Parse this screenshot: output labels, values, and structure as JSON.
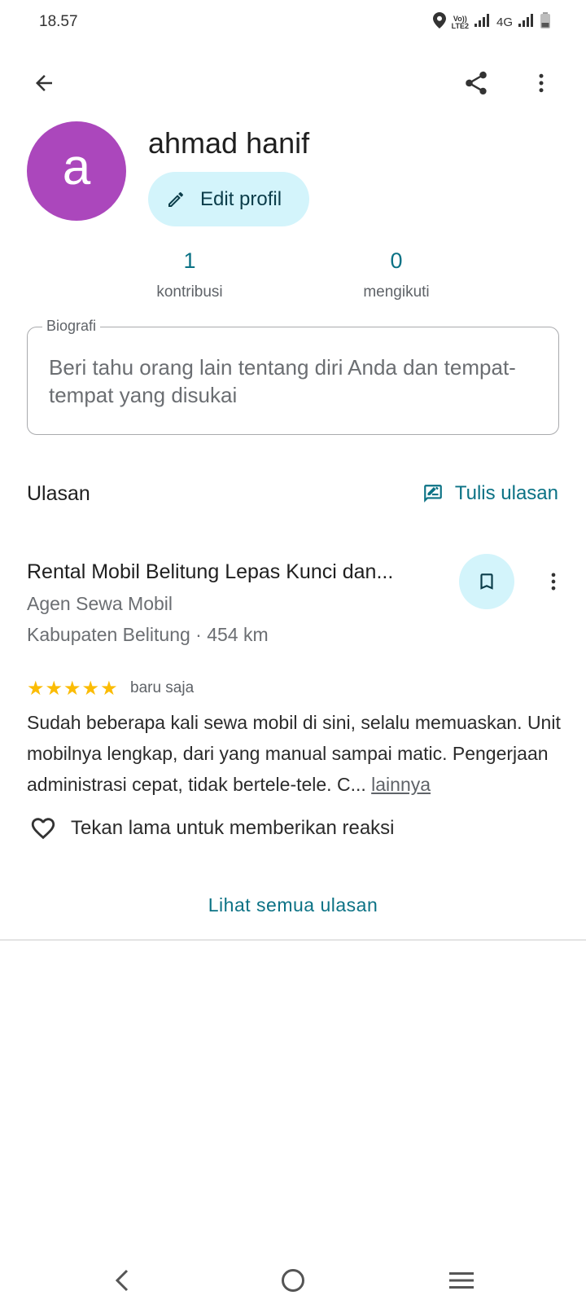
{
  "status": {
    "time": "18.57",
    "volte_top": "Vo))",
    "volte_bottom": "LTE2",
    "network": "4G"
  },
  "profile": {
    "avatar_letter": "a",
    "avatar_color": "#ab47bc",
    "name": "ahmad hanif",
    "edit_label": "Edit profil"
  },
  "stats": [
    {
      "value": "1",
      "label": "kontribusi"
    },
    {
      "value": "0",
      "label": "mengikuti"
    }
  ],
  "bio": {
    "label": "Biografi",
    "placeholder": "Beri tahu orang lain tentang diri Anda dan tempat-tempat yang disukai"
  },
  "reviews_section": {
    "title": "Ulasan",
    "write_label": "Tulis ulasan",
    "see_all_label": "Lihat semua ulasan"
  },
  "review": {
    "place_name": "Rental Mobil Belitung Lepas Kunci dan...",
    "category": "Agen Sewa Mobil",
    "location": "Kabupaten Belitung · 454 km",
    "rating": 5,
    "time": "baru saja",
    "text": "Sudah beberapa kali sewa mobil di sini, selalu memuaskan. Unit mobilnya lengkap, dari yang manual sampai matic. Pengerjaan administrasi cepat, tidak bertele-tele. C...",
    "more_label": "lainnya",
    "react_label": "Tekan lama untuk memberikan reaksi"
  },
  "colors": {
    "accent": "#0b7285",
    "chip_bg": "#d3f4fb",
    "star": "#fbbc04"
  }
}
